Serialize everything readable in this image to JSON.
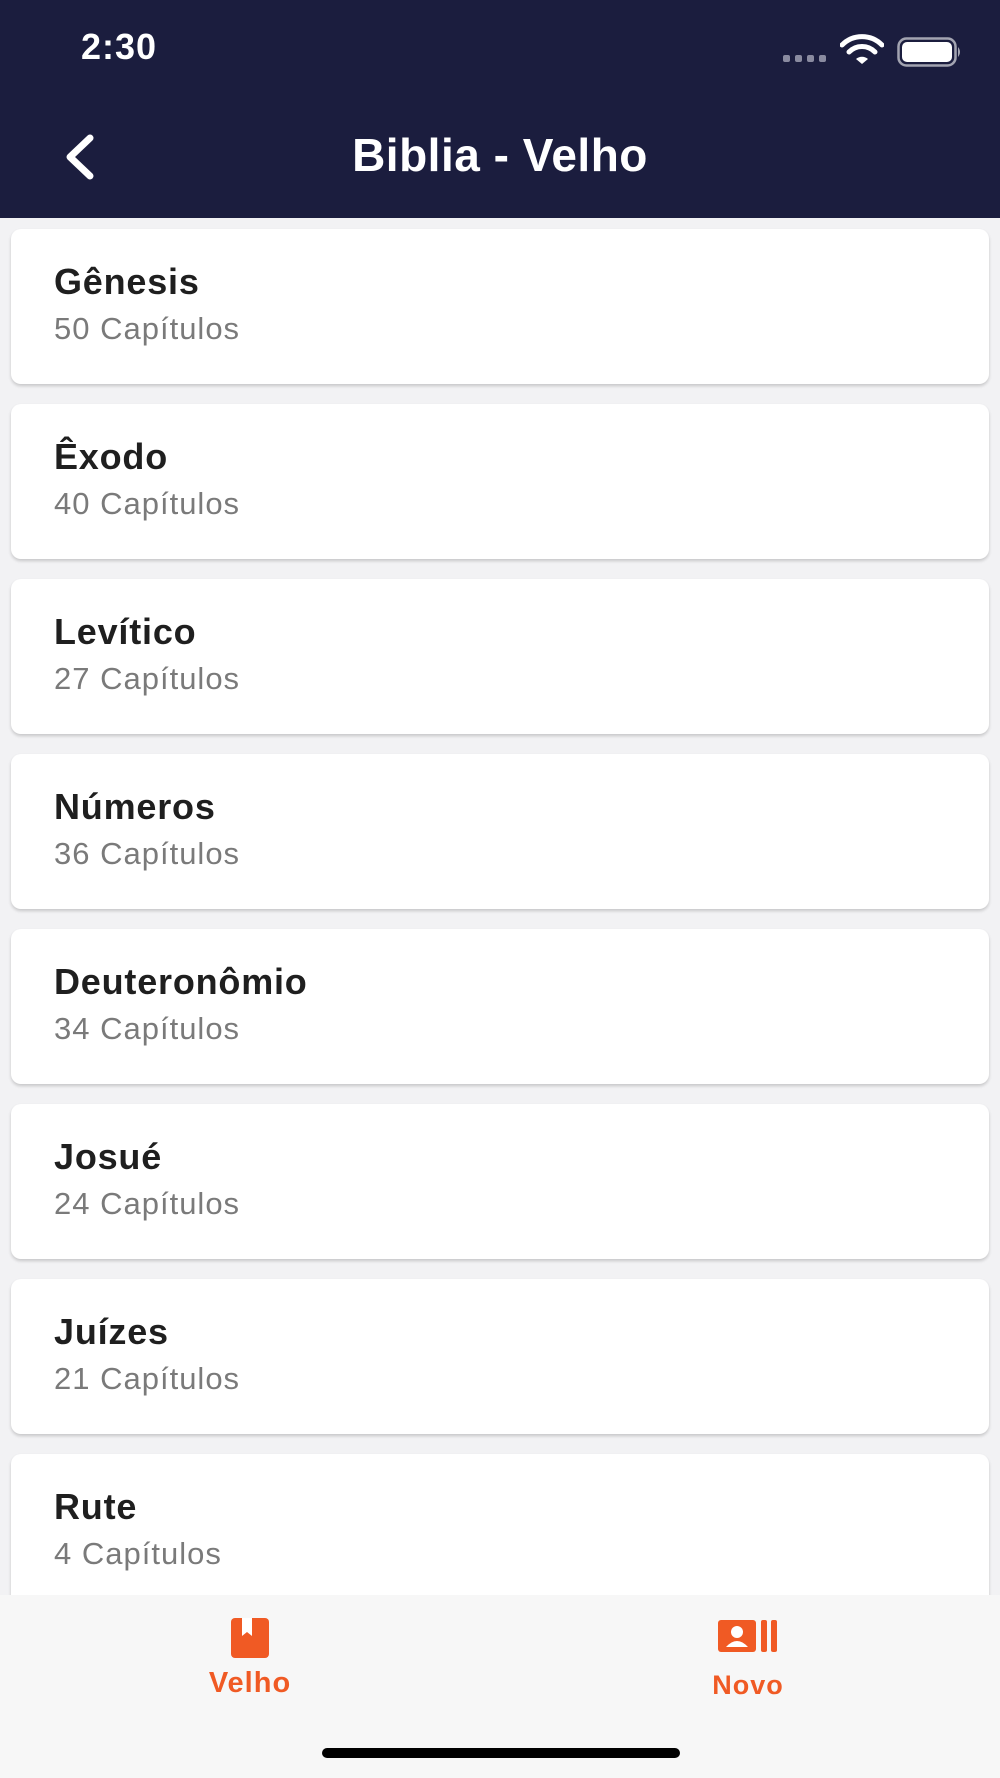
{
  "status_bar": {
    "time": "2:30"
  },
  "header": {
    "title": "Biblia - Velho"
  },
  "books": [
    {
      "name": "Gênesis",
      "chapters": "50 Capítulos"
    },
    {
      "name": "Êxodo",
      "chapters": "40 Capítulos"
    },
    {
      "name": "Levítico",
      "chapters": "27 Capítulos"
    },
    {
      "name": "Números",
      "chapters": "36 Capítulos"
    },
    {
      "name": "Deuteronômio",
      "chapters": "34 Capítulos"
    },
    {
      "name": "Josué",
      "chapters": "24 Capítulos"
    },
    {
      "name": "Juízes",
      "chapters": "21 Capítulos"
    },
    {
      "name": "Rute",
      "chapters": "4 Capítulos"
    }
  ],
  "tabs": [
    {
      "label": "Velho",
      "icon": "book-icon",
      "active": true
    },
    {
      "label": "Novo",
      "icon": "contacts-book-icon",
      "active": false
    }
  ],
  "colors": {
    "header_bg": "#1b1d3e",
    "accent": "#f05a24"
  }
}
